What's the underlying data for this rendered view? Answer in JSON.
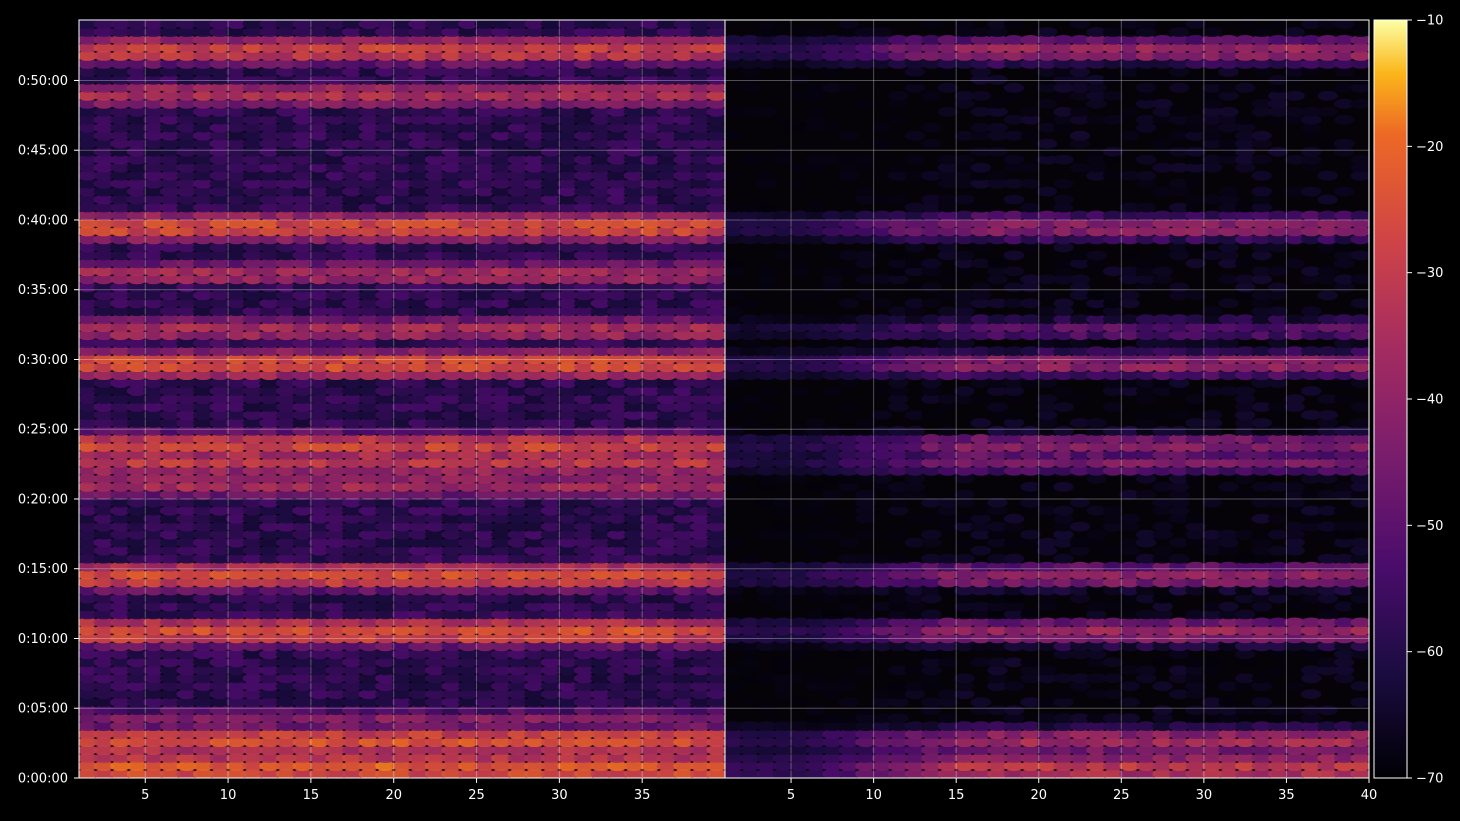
{
  "chart_data": {
    "type": "heatmap",
    "colormap": "inferno",
    "background": "#000000",
    "grid": true,
    "panels": [
      {
        "name": "",
        "x_ticks": [
          "5",
          "10",
          "15",
          "20",
          "25",
          "30",
          "35"
        ],
        "x_range": [
          1,
          40
        ],
        "y_range_seconds": [
          0,
          3260
        ],
        "y_ticks": [
          "0:00:00",
          "0:05:00",
          "0:10:00",
          "0:15:00",
          "0:20:00",
          "0:25:00",
          "0:30:00",
          "0:35:00",
          "0:40:00",
          "0:45:00",
          "0:50:00"
        ],
        "bright_bands": [
          {
            "time": "0:00:45",
            "intensity": -22
          },
          {
            "time": "0:02:40",
            "intensity": -24
          },
          {
            "time": "0:04:10",
            "intensity": -42
          },
          {
            "time": "0:10:30",
            "intensity": -24
          },
          {
            "time": "0:14:30",
            "intensity": -25
          },
          {
            "time": "0:21:00",
            "intensity": -36
          },
          {
            "time": "0:22:40",
            "intensity": -30
          },
          {
            "time": "0:23:50",
            "intensity": -27
          },
          {
            "time": "0:29:40",
            "intensity": -24
          },
          {
            "time": "0:32:10",
            "intensity": -35
          },
          {
            "time": "0:36:10",
            "intensity": -36
          },
          {
            "time": "0:39:30",
            "intensity": -25
          },
          {
            "time": "0:49:00",
            "intensity": -34
          },
          {
            "time": "0:52:10",
            "intensity": -28
          }
        ]
      },
      {
        "name": "",
        "x_ticks": [
          "5",
          "10",
          "15",
          "20",
          "25",
          "30",
          "35",
          "40"
        ],
        "x_range": [
          1,
          40
        ],
        "y_range_seconds": [
          0,
          3260
        ],
        "bright_bands": [
          {
            "time": "0:00:45",
            "intensity": -30
          },
          {
            "time": "0:02:40",
            "intensity": -36
          },
          {
            "time": "0:10:30",
            "intensity": -38
          },
          {
            "time": "0:14:30",
            "intensity": -40
          },
          {
            "time": "0:22:40",
            "intensity": -44
          },
          {
            "time": "0:23:50",
            "intensity": -42
          },
          {
            "time": "0:29:40",
            "intensity": -40
          },
          {
            "time": "0:32:10",
            "intensity": -50
          },
          {
            "time": "0:39:30",
            "intensity": -40
          },
          {
            "time": "0:52:10",
            "intensity": -38
          }
        ]
      }
    ],
    "colorbar": {
      "ticks": [
        "−10",
        "−20",
        "−30",
        "−40",
        "−50",
        "−60",
        "−70"
      ],
      "range": [
        -70,
        -10
      ]
    }
  }
}
